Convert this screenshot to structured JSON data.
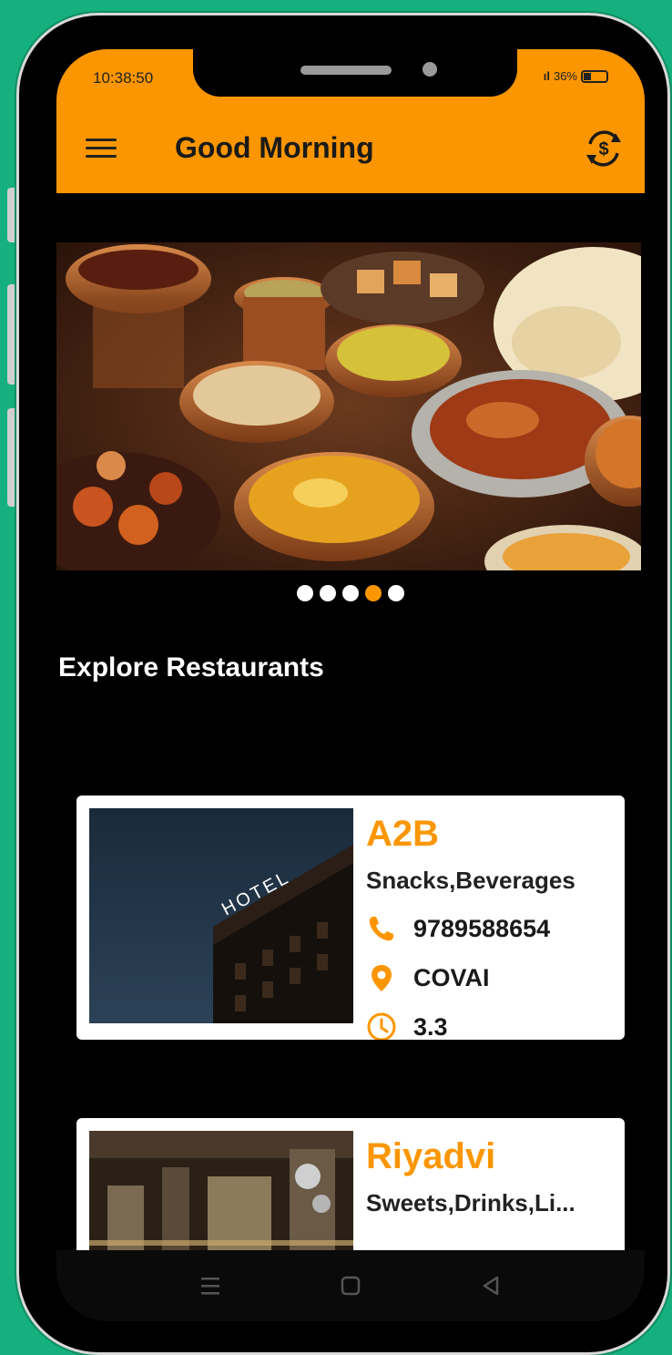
{
  "status_bar": {
    "time": "10:38:50",
    "signal": "ıl",
    "battery": "36%"
  },
  "header": {
    "title": "Good Morning",
    "menu_icon": "menu-icon",
    "right_icon": "currency-refresh-icon",
    "background": "#fb9600"
  },
  "banner": {
    "image": "indian-food-spread",
    "active_dot_index": 3,
    "dot_count": 5
  },
  "section": {
    "title": "Explore Restaurants"
  },
  "restaurants": [
    {
      "name": "A2B",
      "categories": "Snacks,Beverages",
      "phone": "9789588654",
      "location": "COVAI",
      "rating": "3.3",
      "image": "hotel-building"
    },
    {
      "name": "Riyadvi",
      "categories": "Sweets,Drinks,Li...",
      "image": "restaurant-interior"
    }
  ],
  "colors": {
    "accent": "#fb9600",
    "background": "#000000",
    "page_bg": "#16b07e"
  }
}
